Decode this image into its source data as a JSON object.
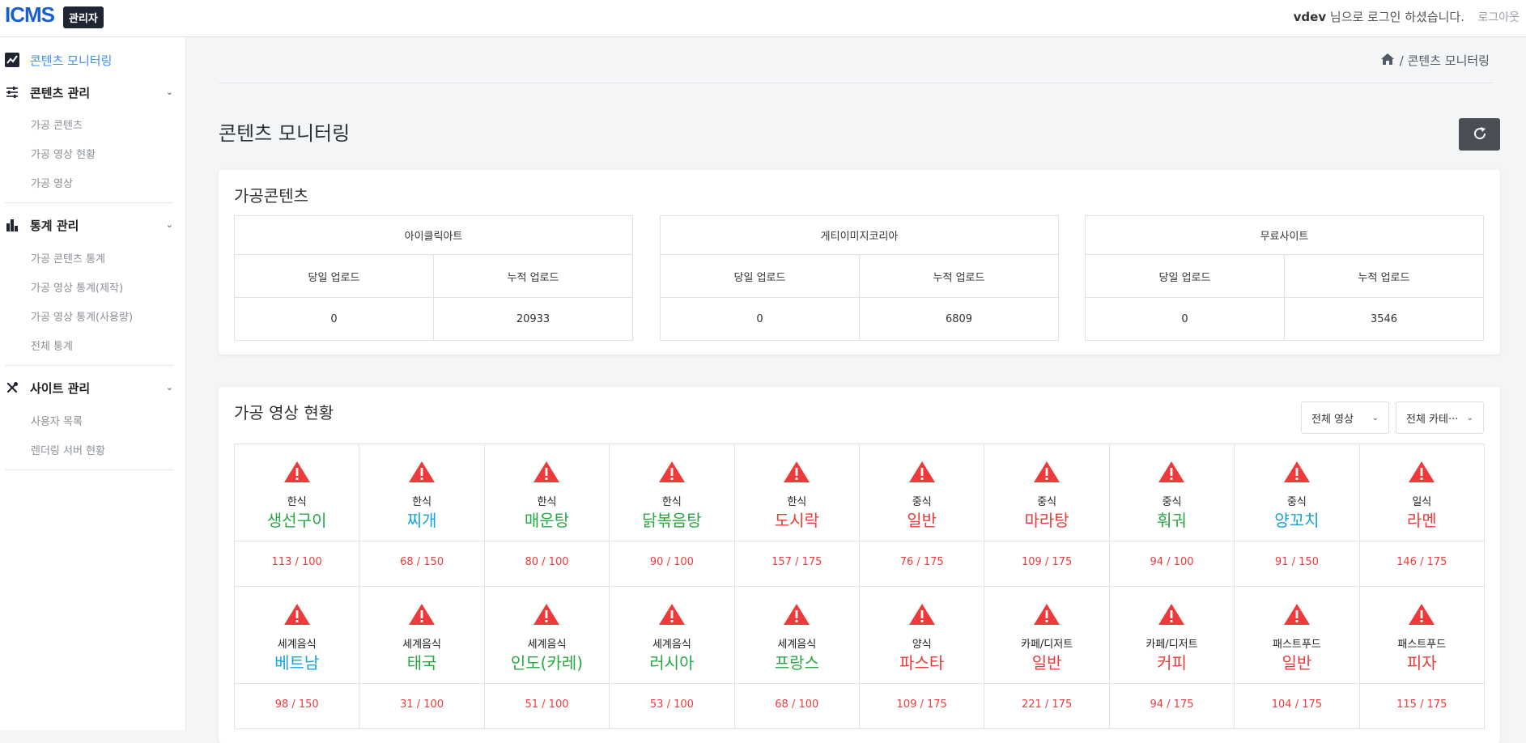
{
  "topbar": {
    "logo": "ICMS",
    "badge": "관리자",
    "user": "vdev",
    "greeting": " 님으로 로그인 하셨습니다.",
    "logout": "로그아웃"
  },
  "sidebar": {
    "monitor": "콘텐츠 모니터링",
    "content_mgmt": "콘텐츠 관리",
    "content_items": [
      "가공 콘텐츠",
      "가공 영상 현황",
      "가공 영상"
    ],
    "stats_mgmt": "통계 관리",
    "stats_items": [
      "가공 콘텐츠 통계",
      "가공 영상 통계(제작)",
      "가공 영상 통계(사용량)",
      "전체 통계"
    ],
    "site_mgmt": "사이트 관리",
    "site_items": [
      "사용자 목록",
      "렌더링 서버 현황"
    ]
  },
  "breadcrumb": {
    "current": "/ 콘텐츠 모니터링"
  },
  "page_title": "콘텐츠 모니터링",
  "processed": {
    "title": "가공콘텐츠",
    "sites": [
      {
        "name": "아이클릭아트",
        "today_label": "당일 업로드",
        "total_label": "누적 업로드",
        "today": "0",
        "total": "20933"
      },
      {
        "name": "게티이미지코리아",
        "today_label": "당일 업로드",
        "total_label": "누적 업로드",
        "today": "0",
        "total": "6809"
      },
      {
        "name": "무료사이트",
        "today_label": "당일 업로드",
        "total_label": "누적 업로드",
        "today": "0",
        "total": "3546"
      }
    ]
  },
  "videos": {
    "title": "가공 영상 현황",
    "filter_video": "전체 영상",
    "filter_category": "전체 카테···",
    "colors": {
      "green": "#28a745",
      "blue": "#17a2d8",
      "red": "#ee3a3a",
      "warn": "#ee3a3a"
    },
    "items": [
      {
        "cat": "한식",
        "name": "생선구이",
        "count": "113 / 100",
        "color": "green"
      },
      {
        "cat": "한식",
        "name": "찌개",
        "count": "68 / 150",
        "color": "blue"
      },
      {
        "cat": "한식",
        "name": "매운탕",
        "count": "80 / 100",
        "color": "green"
      },
      {
        "cat": "한식",
        "name": "닭볶음탕",
        "count": "90 / 100",
        "color": "green"
      },
      {
        "cat": "한식",
        "name": "도시락",
        "count": "157 / 175",
        "color": "red"
      },
      {
        "cat": "중식",
        "name": "일반",
        "count": "76 / 175",
        "color": "red"
      },
      {
        "cat": "중식",
        "name": "마라탕",
        "count": "109 / 175",
        "color": "red"
      },
      {
        "cat": "중식",
        "name": "훠궈",
        "count": "94 / 100",
        "color": "green"
      },
      {
        "cat": "중식",
        "name": "양꼬치",
        "count": "91 / 150",
        "color": "blue"
      },
      {
        "cat": "일식",
        "name": "라멘",
        "count": "146 / 175",
        "color": "red"
      },
      {
        "cat": "세계음식",
        "name": "베트남",
        "count": "98 / 150",
        "color": "blue"
      },
      {
        "cat": "세계음식",
        "name": "태국",
        "count": "31 / 100",
        "color": "green"
      },
      {
        "cat": "세계음식",
        "name": "인도(카레)",
        "count": "51 / 100",
        "color": "green"
      },
      {
        "cat": "세계음식",
        "name": "러시아",
        "count": "53 / 100",
        "color": "green"
      },
      {
        "cat": "세계음식",
        "name": "프랑스",
        "count": "68 / 100",
        "color": "green"
      },
      {
        "cat": "양식",
        "name": "파스타",
        "count": "109 / 175",
        "color": "red"
      },
      {
        "cat": "카페/디저트",
        "name": "일반",
        "count": "221 / 175",
        "color": "red"
      },
      {
        "cat": "카페/디저트",
        "name": "커피",
        "count": "94 / 175",
        "color": "red"
      },
      {
        "cat": "패스트푸드",
        "name": "일반",
        "count": "104 / 175",
        "color": "red"
      },
      {
        "cat": "패스트푸드",
        "name": "피자",
        "count": "115 / 175",
        "color": "red"
      }
    ]
  }
}
